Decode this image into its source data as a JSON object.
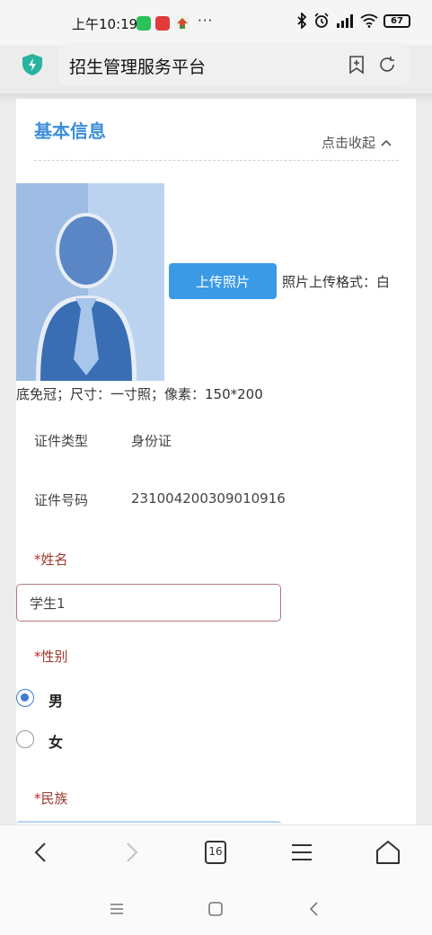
{
  "status_bar": {
    "time": "上午10:19",
    "more": "···",
    "battery": "67"
  },
  "address_bar": {
    "title": "招生管理服务平台"
  },
  "section": {
    "title": "基本信息",
    "collapse_label": "点击收起"
  },
  "upload": {
    "button_label": "上传照片",
    "note_line1": "照片上传格式：白",
    "note_line2": "底免冠；尺寸：一寸照；像素：150*200"
  },
  "fields": {
    "id_type_label": "证件类型",
    "id_type_value": "身份证",
    "id_number_label": "证件号码",
    "id_number_value": "231004200309010916",
    "name_label": "姓名",
    "name_value": "学生1",
    "gender_label": "性别",
    "gender_options": [
      "男",
      "女"
    ],
    "gender_selected": "男",
    "ethnic_label": "民族",
    "required_mark": "*"
  },
  "browser_nav": {
    "tab_count": "16"
  },
  "colors": {
    "accent": "#3b8ed8",
    "button": "#3a9ae6",
    "required": "#c2272d",
    "radio_checked": "#3a7bd5"
  }
}
